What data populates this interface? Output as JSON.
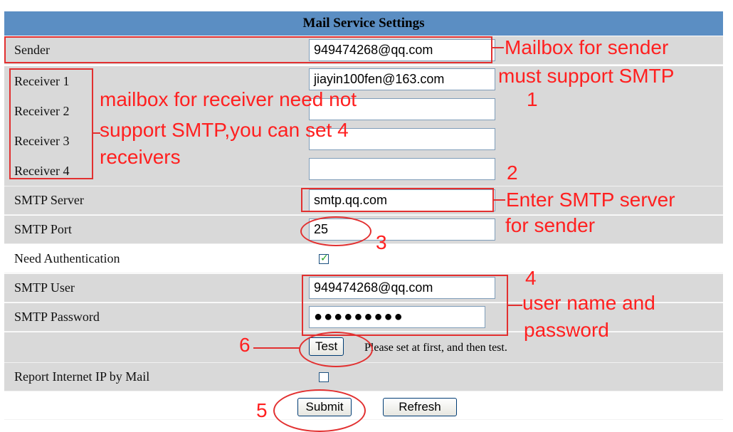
{
  "panel": {
    "title": "Mail Service Settings"
  },
  "fields": {
    "sender": {
      "label": "Sender",
      "value": "949474268@qq.com"
    },
    "receiver1": {
      "label": "Receiver 1",
      "value": "jiayin100fen@163.com"
    },
    "receiver2": {
      "label": "Receiver 2",
      "value": ""
    },
    "receiver3": {
      "label": "Receiver 3",
      "value": ""
    },
    "receiver4": {
      "label": "Receiver 4",
      "value": ""
    },
    "smtp_server": {
      "label": "SMTP Server",
      "value": "smtp.qq.com"
    },
    "smtp_port": {
      "label": "SMTP Port",
      "value": "25"
    },
    "need_auth": {
      "label": "Need Authentication",
      "checked": true
    },
    "smtp_user": {
      "label": "SMTP User",
      "value": "949474268@qq.com"
    },
    "smtp_password": {
      "label": "SMTP Password",
      "value": "●●●●●●●●●"
    },
    "report_ip": {
      "label": "Report Internet IP by Mail",
      "checked": false
    }
  },
  "test": {
    "button_label": "Test",
    "hint": "Please set at first, and then test."
  },
  "actions": {
    "submit_label": "Submit",
    "refresh_label": "Refresh"
  },
  "annotations": {
    "sender_note_line1": "Mailbox for sender",
    "sender_note_line2": "must support SMTP",
    "sender_step": "1",
    "receiver_note_line1": "mailbox for receiver need not",
    "receiver_note_line2": "support SMTP,you can set 4",
    "receiver_note_line3": "receivers",
    "server_step": "2",
    "server_note_line1": "Enter SMTP server",
    "server_note_line2": "for sender",
    "port_step": "3",
    "user_step": "4",
    "user_note_line1": "user name and",
    "user_note_line2": "password",
    "submit_step": "5",
    "test_step": "6"
  },
  "colors": {
    "header_bg": "#5b8ec3",
    "row_bg": "#d9d9d9",
    "annotation": "#ff2020"
  }
}
